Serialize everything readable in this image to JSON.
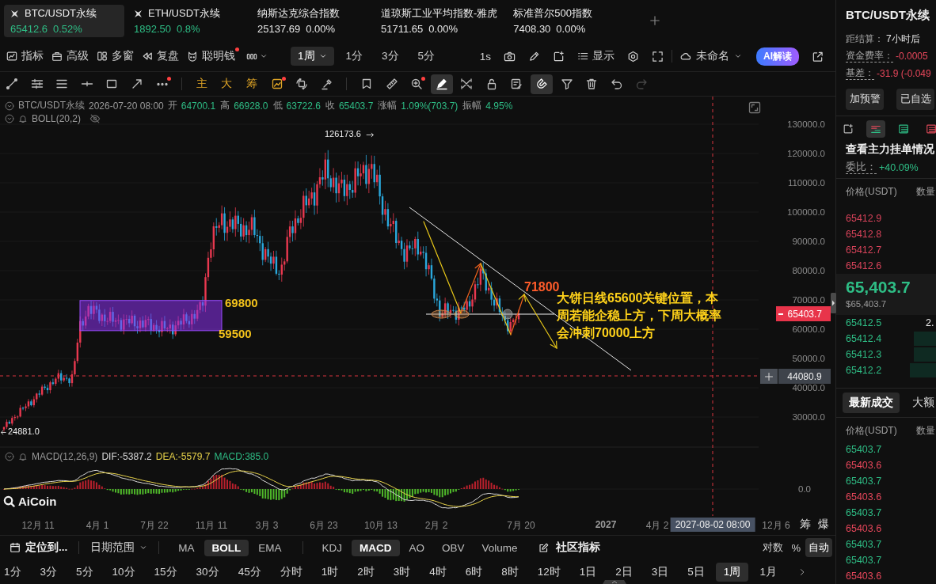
{
  "ticker_tabs": [
    {
      "kind": "crypto",
      "symbol": "BTC/USDT永续",
      "price": "65412.6",
      "change": "0.52%",
      "rising": true,
      "selected": true
    },
    {
      "kind": "crypto",
      "symbol": "ETH/USDT永续",
      "price": "1892.50",
      "change": "0.8%",
      "rising": true,
      "selected": false
    },
    {
      "kind": "index",
      "symbol": "纳斯达克综合指数",
      "price": "25137.69",
      "change": "0.00%",
      "rising": false,
      "selected": false
    },
    {
      "kind": "index",
      "symbol": "道琼斯工业平均指数-雅虎",
      "price": "51711.65",
      "change": "0.00%",
      "rising": false,
      "selected": false
    },
    {
      "kind": "index",
      "symbol": "标准普尔500指数",
      "price": "7408.30",
      "change": "0.00%",
      "rising": false,
      "selected": false
    }
  ],
  "main_toolbar": {
    "tools": [
      {
        "label": "指标",
        "dot": false
      },
      {
        "label": "高级",
        "dot": false
      },
      {
        "label": "多窗",
        "dot": false
      },
      {
        "label": "复盘",
        "dot": false
      },
      {
        "label": "聪明钱",
        "dot": true
      }
    ],
    "intervals": [
      {
        "label": "1周",
        "kind": "dropdown",
        "selected": true
      },
      {
        "label": "1分",
        "kind": "plain",
        "selected": false
      },
      {
        "label": "3分",
        "kind": "plain",
        "selected": false
      },
      {
        "label": "5分",
        "kind": "plain",
        "selected": false
      }
    ],
    "tick_button": "1s",
    "display_button": "显示",
    "layout_name": "未命名",
    "ai_button": "AI解读"
  },
  "drawing_toolbar": {
    "groups": [
      [
        {
          "kind": "icon",
          "selected": false,
          "dot": false,
          "disabled": false
        },
        {
          "kind": "icon",
          "selected": false,
          "dot": false,
          "disabled": false
        },
        {
          "kind": "icon",
          "selected": false,
          "dot": false,
          "disabled": false
        },
        {
          "kind": "icon",
          "selected": false,
          "dot": false,
          "disabled": false
        },
        {
          "kind": "icon",
          "selected": false,
          "dot": false,
          "disabled": false
        },
        {
          "kind": "icon",
          "selected": false,
          "dot": false,
          "disabled": false
        },
        {
          "kind": "icon",
          "selected": false,
          "dot": true,
          "disabled": false
        }
      ],
      [
        {
          "kind": "text",
          "label": "主",
          "selected": false,
          "dot": false,
          "disabled": false
        },
        {
          "kind": "text",
          "label": "大",
          "selected": false,
          "dot": false,
          "disabled": false
        },
        {
          "kind": "text",
          "label": "筹",
          "selected": false,
          "dot": false,
          "disabled": false
        },
        {
          "kind": "icon",
          "selected": false,
          "dot": true,
          "disabled": false
        },
        {
          "kind": "icon",
          "selected": false,
          "dot": false,
          "disabled": false
        },
        {
          "kind": "icon",
          "selected": false,
          "dot": false,
          "disabled": false
        }
      ],
      [
        {
          "kind": "icon",
          "selected": false,
          "dot": false,
          "disabled": false
        },
        {
          "kind": "icon",
          "selected": false,
          "dot": false,
          "disabled": false
        },
        {
          "kind": "icon",
          "selected": false,
          "dot": true,
          "disabled": false
        },
        {
          "kind": "icon",
          "selected": true,
          "dot": false,
          "disabled": false
        },
        {
          "kind": "icon",
          "selected": false,
          "dot": false,
          "disabled": false
        },
        {
          "kind": "icon",
          "selected": false,
          "dot": false,
          "disabled": false
        },
        {
          "kind": "icon",
          "selected": false,
          "dot": false,
          "disabled": false
        },
        {
          "kind": "icon",
          "selected": true,
          "dot": false,
          "disabled": false
        },
        {
          "kind": "icon",
          "selected": false,
          "dot": false,
          "disabled": false
        },
        {
          "kind": "icon",
          "selected": false,
          "dot": false,
          "disabled": false
        },
        {
          "kind": "icon",
          "selected": false,
          "dot": false,
          "disabled": false
        },
        {
          "kind": "icon",
          "selected": false,
          "dot": false,
          "disabled": true
        }
      ]
    ]
  },
  "chart_legend": {
    "symbol": "BTC/USDT永续",
    "time": "2026-07-20 08:00",
    "fields": [
      {
        "label": "开",
        "value": "64700.1"
      },
      {
        "label": "高",
        "value": "66928.0"
      },
      {
        "label": "低",
        "value": "63722.6"
      },
      {
        "label": "收",
        "value": "65403.7"
      },
      {
        "label": "涨幅",
        "value": "1.09%(703.7)"
      },
      {
        "label": "振幅",
        "value": "4.95%"
      }
    ],
    "indicator": "BOLL(20,2)",
    "indicator_hidden": true
  },
  "chart": {
    "price_axis": [
      "130000.0",
      "120000.0",
      "110000.0",
      "100000.0",
      "90000.0",
      "80000.0",
      "70000.0",
      "60000.0",
      "50000.0",
      "40000.0",
      "30000.0"
    ],
    "last_price": "65403.7",
    "crosshair_price": "44080.9",
    "high_label": "126173.6",
    "low_label": "24881.0",
    "annotations": [
      {
        "kind": "level",
        "text": "69800"
      },
      {
        "kind": "level",
        "text": "59500"
      },
      {
        "kind": "target",
        "text": "71800"
      },
      {
        "kind": "note",
        "text": "大饼日线65600关键位置，本周若能企稳上方，下周大概率会冲刺70000上方"
      }
    ],
    "logo": "AiCoin"
  },
  "macd": {
    "indicator": "MACD(12,26,9)",
    "values": [
      {
        "kind": "dif",
        "text": "DIF:-5387.2"
      },
      {
        "kind": "dea",
        "text": "DEA:-5579.7"
      },
      {
        "kind": "macd",
        "text": "MACD:385.0"
      }
    ],
    "axis": "0.0"
  },
  "time_axis": {
    "labels": [
      {
        "kind": "month",
        "text": "12月 11"
      },
      {
        "kind": "month",
        "text": "4月 1"
      },
      {
        "kind": "month",
        "text": "7月 22"
      },
      {
        "kind": "month",
        "text": "11月 11"
      },
      {
        "kind": "month",
        "text": "3月 3"
      },
      {
        "kind": "month",
        "text": "6月 23"
      },
      {
        "kind": "month",
        "text": "10月 13"
      },
      {
        "kind": "month",
        "text": "2月 2"
      },
      {
        "kind": "month",
        "text": "7月 20"
      },
      {
        "kind": "year",
        "text": "2027"
      },
      {
        "kind": "month",
        "text": "4月 2"
      },
      {
        "kind": "month",
        "text": "12月 6"
      }
    ],
    "crosshair_time": "2027-08-02 08:00",
    "buttons": [
      "筹",
      "爆"
    ]
  },
  "indicator_bar": {
    "locate_button": "定位到...",
    "date_range": "日期范围",
    "main_indicators": [
      {
        "label": "MA",
        "selected": false
      },
      {
        "label": "BOLL",
        "selected": true
      },
      {
        "label": "EMA",
        "selected": false
      }
    ],
    "sub_indicators": [
      {
        "label": "KDJ",
        "selected": false
      },
      {
        "label": "MACD",
        "selected": true
      },
      {
        "label": "AO",
        "selected": false
      },
      {
        "label": "OBV",
        "selected": false
      },
      {
        "label": "Volume",
        "selected": false
      }
    ],
    "community": "社区指标",
    "scale_options": [
      {
        "label": "对数",
        "selected": false
      },
      {
        "label": "%",
        "selected": false
      },
      {
        "label": "自动",
        "selected": true
      }
    ]
  },
  "timeframes": [
    {
      "label": "1分",
      "selected": false
    },
    {
      "label": "3分",
      "selected": false
    },
    {
      "label": "5分",
      "selected": false
    },
    {
      "label": "10分",
      "selected": false
    },
    {
      "label": "15分",
      "selected": false
    },
    {
      "label": "30分",
      "selected": false
    },
    {
      "label": "45分",
      "selected": false
    },
    {
      "label": "分时",
      "selected": false
    },
    {
      "label": "1时",
      "selected": false
    },
    {
      "label": "2时",
      "selected": false
    },
    {
      "label": "3时",
      "selected": false
    },
    {
      "label": "4时",
      "selected": false
    },
    {
      "label": "6时",
      "selected": false
    },
    {
      "label": "8时",
      "selected": false
    },
    {
      "label": "12时",
      "selected": false
    },
    {
      "label": "1日",
      "selected": false
    },
    {
      "label": "2日",
      "selected": false
    },
    {
      "label": "3日",
      "selected": false
    },
    {
      "label": "5日",
      "selected": false
    },
    {
      "label": "1周",
      "selected": true
    },
    {
      "label": "1月",
      "selected": false
    }
  ],
  "side_panel": {
    "symbol": "BTC/USDT永续",
    "stats": [
      {
        "label": "距结算：",
        "value": "7小时后",
        "negative": false,
        "tooltip": false
      },
      {
        "label": "资金费率：",
        "value": "-0.0005",
        "negative": true,
        "tooltip": true
      },
      {
        "label": "基差：",
        "value": "-31.9 (-0.049",
        "negative": true,
        "tooltip": true
      }
    ],
    "actions": [
      "加预警",
      "已自选"
    ],
    "view_tabs": [
      {
        "selected": false
      },
      {
        "selected": true
      },
      {
        "selected": false
      },
      {
        "selected": false
      }
    ],
    "book_title": "查看主力挂单情况",
    "ratio_label": "委比：",
    "ratio_value": "+40.09%",
    "ratio_positive": true,
    "book_columns": [
      "价格(USDT)",
      "数量"
    ],
    "asks": [
      {
        "price": "65412.9"
      },
      {
        "price": "65412.8"
      },
      {
        "price": "65412.7"
      },
      {
        "price": "65412.6"
      }
    ],
    "last_price": "65,403.7",
    "last_price_usd": "$65,403.7",
    "bids": [
      {
        "price": "65412.5",
        "amount": "2.",
        "level": 0
      },
      {
        "price": "65412.4",
        "level": 0.22
      },
      {
        "price": "65412.3",
        "level": 0.22
      },
      {
        "price": "65412.2",
        "level": 0.26
      }
    ],
    "trade_tabs": [
      {
        "label": "最新成交",
        "selected": true
      },
      {
        "label": "大额",
        "selected": false
      }
    ],
    "trade_columns": [
      "价格(USDT)",
      "数量"
    ],
    "trades": [
      {
        "price": "65403.7",
        "buy": true
      },
      {
        "price": "65403.6",
        "buy": false
      },
      {
        "price": "65403.7",
        "buy": true
      },
      {
        "price": "65403.6",
        "buy": false
      },
      {
        "price": "65403.7",
        "buy": true
      },
      {
        "price": "65403.6",
        "buy": false
      },
      {
        "price": "65403.7",
        "buy": true
      },
      {
        "price": "65403.7",
        "buy": true
      },
      {
        "price": "65403.6",
        "buy": false
      }
    ]
  }
}
